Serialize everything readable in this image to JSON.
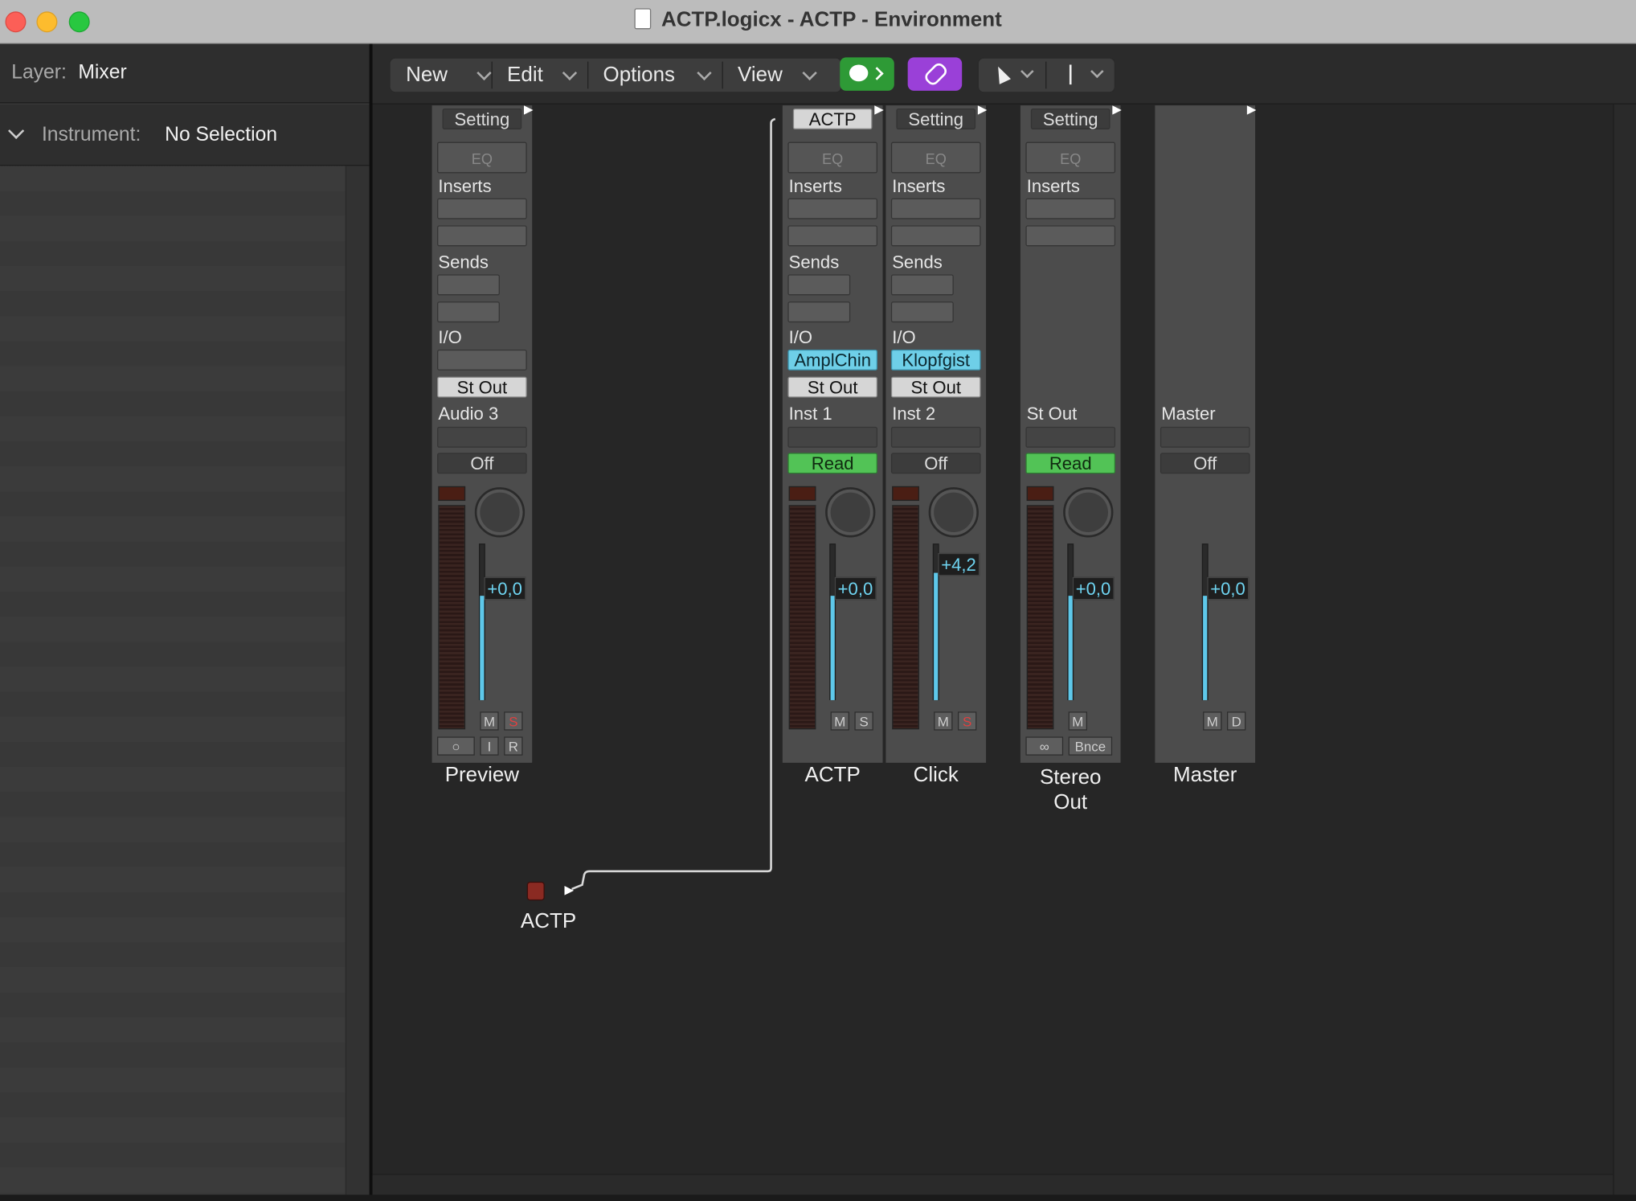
{
  "window": {
    "title": "ACTP.logicx - ACTP - Environment"
  },
  "inspector": {
    "layer_label": "Layer:",
    "layer_value": "Mixer",
    "instrument_label": "Instrument:",
    "instrument_value": "No Selection"
  },
  "toolbar": {
    "menus": [
      "New",
      "Edit",
      "Options",
      "View"
    ]
  },
  "strips": [
    {
      "id": "preview",
      "setting": "Setting",
      "eq": "EQ",
      "inserts": "Inserts",
      "sends": "Sends",
      "io": "I/O",
      "input": "",
      "output": "St Out",
      "channel": "Audio 3",
      "automation": "Off",
      "fader_value": "+0,0",
      "name": "Preview",
      "bottom_btns": [
        "I",
        "R"
      ],
      "ms": [
        "M",
        "S"
      ]
    },
    {
      "id": "actp",
      "setting": "ACTP",
      "eq": "EQ",
      "inserts": "Inserts",
      "sends": "Sends",
      "io": "I/O",
      "input": "AmplChin",
      "output": "St Out",
      "channel": "Inst 1",
      "automation": "Read",
      "fader_value": "+0,0",
      "name": "ACTP",
      "ms": [
        "M",
        "S"
      ]
    },
    {
      "id": "click",
      "setting": "Setting",
      "eq": "EQ",
      "inserts": "Inserts",
      "sends": "Sends",
      "io": "I/O",
      "input": "Klopfgist",
      "output": "St Out",
      "channel": "Inst 2",
      "automation": "Off",
      "fader_value": "+4,2",
      "name": "Click",
      "ms": [
        "M",
        "S"
      ]
    },
    {
      "id": "stereo-out",
      "setting": "Setting",
      "eq": "EQ",
      "inserts": "Inserts",
      "channel": "St Out",
      "automation": "Read",
      "fader_value": "+0,0",
      "name": "Stereo Out",
      "bottom_btns": [
        "Bnce"
      ],
      "ms": [
        "M"
      ]
    },
    {
      "id": "master",
      "channel": "Master",
      "automation": "Off",
      "fader_value": "+0,0",
      "name": "Master",
      "ms": [
        "M",
        "D"
      ]
    }
  ],
  "objects": [
    {
      "id": "actp-instrument",
      "label": "ACTP"
    }
  ],
  "colors": {
    "green_button": "#2e9a36",
    "purple_button": "#9a40d8",
    "fader_blue": "#5ec8ea",
    "input_blue": "#6ecfe8",
    "read_green": "#52c356"
  }
}
